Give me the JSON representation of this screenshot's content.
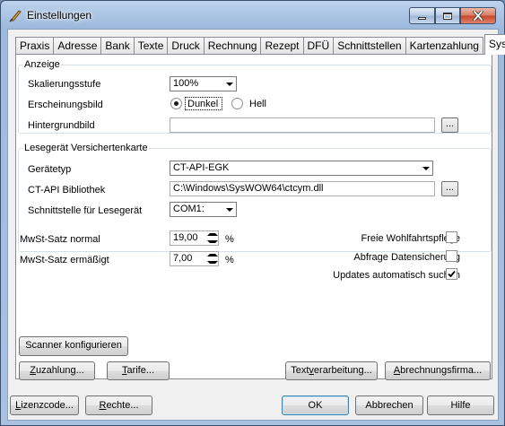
{
  "window": {
    "title": "Einstellungen",
    "icon": "app-feather-icon"
  },
  "tabs": [
    "Praxis",
    "Adresse",
    "Bank",
    "Texte",
    "Druck",
    "Rechnung",
    "Rezept",
    "DFÜ",
    "Schnittstellen",
    "Kartenzahlung",
    "System"
  ],
  "active_tab": "System",
  "anzeige": {
    "title": "Anzeige",
    "skalierung_label": "Skalierungsstufe",
    "skalierung_value": "100%",
    "erscheinung_label": "Erscheinungsbild",
    "option_dunkel": "Dunkel",
    "option_hell": "Hell",
    "selected": "Dunkel",
    "hintergrund_label": "Hintergrundbild",
    "hintergrund_value": "",
    "browse_label": "..."
  },
  "lesegeraet": {
    "title": "Lesegerät Versichertenkarte",
    "typ_label": "Gerätetyp",
    "typ_value": "CT-API-EGK",
    "bibliothek_label": "CT-API Bibliothek",
    "bibliothek_value": "C:\\Windows\\SysWOW64\\ctcym.dll",
    "browse_label": "...",
    "schnittstelle_label": "Schnittstelle für Lesegerät",
    "schnittstelle_value": "COM1:"
  },
  "mwst": {
    "normal_label": "MwSt-Satz normal",
    "normal_value": "19,00",
    "ermaessigt_label": "MwSt-Satz ermäßigt",
    "ermaessigt_value": "7,00",
    "percent": "%"
  },
  "options": {
    "wohlfahrt_label": "Freie Wohlfahrtspflege",
    "wohlfahrt_checked": false,
    "datensicherung_label": "Abfrage Datensicherung",
    "datensicherung_checked": false,
    "updates_label": "Updates automatisch suchen",
    "updates_checked": true
  },
  "buttons": {
    "scanner": "Scanner konfigurieren",
    "zuzahlung_pre": "Z",
    "zuzahlung_rest": "uzahlung...",
    "tarife_pre": "T",
    "tarife_rest": "arife...",
    "text_pre": "Text",
    "text_u": "v",
    "text_rest": "erarbeitung...",
    "abrechnung_pre": "A",
    "abrechnung_rest": "brechnungsfirma...",
    "lizenz_pre": "L",
    "lizenz_rest": "izenzcode...",
    "rechte_pre": "R",
    "rechte_rest": "echte...",
    "ok": "OK",
    "abbrechen": "Abbrechen",
    "hilfe": "Hilfe"
  }
}
